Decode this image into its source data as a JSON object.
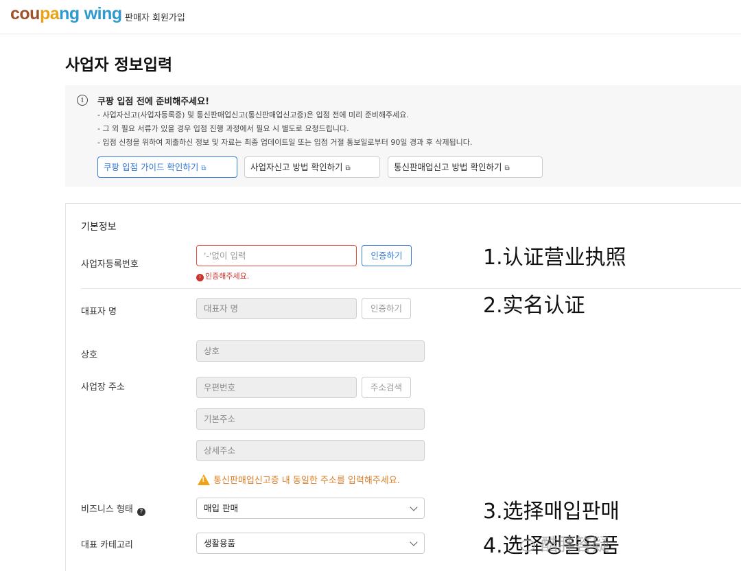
{
  "header": {
    "logo_text": "coupang wing",
    "subtitle": "판매자 회원가입"
  },
  "page_title": "사업자 정보입력",
  "notice": {
    "title": "쿠팡 입점 전에 준비해주세요!",
    "lines": [
      "- 사업자신고(사업자등록증) 및 통신판매업신고(통신판매업신고증)은 입점 전에 미리 준비해주세요.",
      "- 그 외 필요 서류가 있을 경우 입점 진행 과정에서 필요 시 별도로 요청드립니다.",
      "- 입점 신청을 위하여 제출하신 정보 및 자료는 최종 업데이트일 또는 입점 거절 통보일로부터 90일 경과 후 삭제됩니다."
    ],
    "buttons": [
      "쿠팡 입점 가이드 확인하기",
      "사업자신고 방법 확인하기",
      "통신판매업신고 방법 확인하기"
    ]
  },
  "form": {
    "section_title": "기본정보",
    "business_number": {
      "label": "사업자등록번호",
      "placeholder": "'-'없이 입력",
      "button": "인증하기",
      "error": "인증해주세요."
    },
    "representative": {
      "label": "대표자 명",
      "placeholder": "대표자 명",
      "button": "인증하기"
    },
    "company": {
      "label": "상호",
      "placeholder": "상호"
    },
    "address": {
      "label": "사업장 주소",
      "postcode_placeholder": "우편번호",
      "search_button": "주소검색",
      "basic_placeholder": "기본주소",
      "detail_placeholder": "상세주소",
      "warning": "통신판매업신고증 내 동일한 주소를 입력해주세요."
    },
    "business_type": {
      "label": "비즈니스 형태",
      "value": "매입 판매"
    },
    "category": {
      "label": "대표 카테고리",
      "value": "생활용품"
    }
  },
  "annotations": [
    "1.认证营业执照",
    "2.实名认证",
    "3.选择매입판매",
    "4.选择생활용품"
  ],
  "watermark": "酷胖答疑",
  "colors": {
    "primary": "#3478d4",
    "error": "#d0312d",
    "warning": "#f0a31a"
  }
}
